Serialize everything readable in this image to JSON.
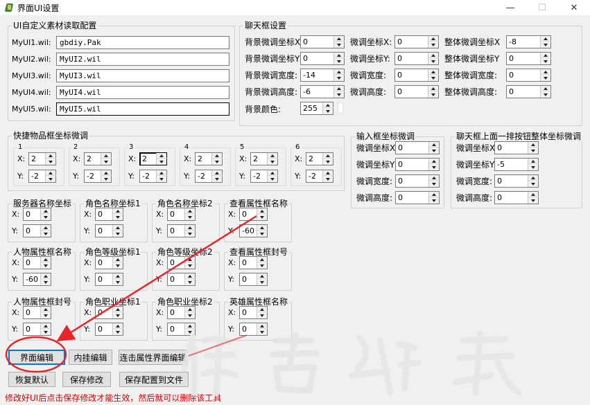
{
  "window": {
    "title": "界面UI设置",
    "minimize": "—",
    "maximize": "☐",
    "close": "✕"
  },
  "ui_group": {
    "title": "UI自定义素材读取配置",
    "rows": [
      {
        "label": "MyUI1.wil:",
        "value": "gbdiy.Pak"
      },
      {
        "label": "MyUI2.wil:",
        "value": "MyUI2.wil"
      },
      {
        "label": "MyUI3.wil:",
        "value": "MyUI3.wil"
      },
      {
        "label": "MyUI4.wil:",
        "value": "MyUI4.wil"
      },
      {
        "label": "MyUI5.wil:",
        "value": "MyUI5.wil"
      }
    ]
  },
  "chat_group": {
    "title": "聊天框设置",
    "col1": [
      {
        "label": "背景微调坐标X",
        "value": "0"
      },
      {
        "label": "背景微调坐标Y",
        "value": "0"
      },
      {
        "label": "背景微调宽度:",
        "value": "-14"
      },
      {
        "label": "背景微调高度:",
        "value": "-6"
      },
      {
        "label": "背景颜色:",
        "value": "255"
      }
    ],
    "col2": [
      {
        "label": "微调坐标X:",
        "value": "0"
      },
      {
        "label": "微调坐标Y:",
        "value": "0"
      },
      {
        "label": "微调宽度:",
        "value": "0"
      },
      {
        "label": "微调高度:",
        "value": "0"
      }
    ],
    "col3": [
      {
        "label": "整体微调坐标X",
        "value": "-8"
      },
      {
        "label": "整体微调坐标Y",
        "value": "0"
      },
      {
        "label": "整体微调宽度:",
        "value": "0"
      },
      {
        "label": "整体微调高度:",
        "value": "0"
      }
    ]
  },
  "quick_group": {
    "title": "快捷物品框坐标微调",
    "slots": [
      {
        "name": "1",
        "x": "2",
        "y": "-2"
      },
      {
        "name": "2",
        "x": "2",
        "y": "-2"
      },
      {
        "name": "3",
        "x": "2",
        "y": "-2"
      },
      {
        "name": "4",
        "x": "2",
        "y": "-2"
      },
      {
        "name": "5",
        "x": "2",
        "y": "-2"
      },
      {
        "name": "6",
        "x": "2",
        "y": "-2"
      }
    ]
  },
  "input_group": {
    "title": "输入框坐标微调",
    "rows": [
      {
        "label": "微调坐标X",
        "value": "0"
      },
      {
        "label": "微调坐标Y",
        "value": "0"
      },
      {
        "label": "微调宽度:",
        "value": "0"
      },
      {
        "label": "微调高度:",
        "value": "0"
      }
    ]
  },
  "chatbtn_group": {
    "title": "聊天框上面一排按钮整体坐标微调",
    "rows": [
      {
        "label": "微调坐标X",
        "value": "0"
      },
      {
        "label": "微调坐标Y",
        "value": "-5"
      },
      {
        "label": "微调宽度:",
        "value": "0"
      },
      {
        "label": "微调高度:",
        "value": "0"
      }
    ]
  },
  "coord_groups": [
    {
      "title": "服务器名称坐标",
      "x": "0",
      "y": "0"
    },
    {
      "title": "角色名称坐标1",
      "x": "0",
      "y": "0"
    },
    {
      "title": "角色名称坐标2",
      "x": "0",
      "y": "0"
    },
    {
      "title": "查看属性框名称",
      "x": "0",
      "y": "-60"
    },
    {
      "title": "人物属性框名称",
      "x": "0",
      "y": "-60"
    },
    {
      "title": "角色等级坐标1",
      "x": "0",
      "y": "0"
    },
    {
      "title": "角色等级坐标2",
      "x": "0",
      "y": "0"
    },
    {
      "title": "查看属性框封号",
      "x": "0",
      "y": "0"
    },
    {
      "title": "人物属性框封号",
      "x": "0",
      "y": "0"
    },
    {
      "title": "角色职业坐标1",
      "x": "0",
      "y": "0"
    },
    {
      "title": "角色职业坐标2",
      "x": "0",
      "y": "0"
    },
    {
      "title": "英雄属性框名称",
      "x": "0",
      "y": "0"
    }
  ],
  "axis": {
    "x": "X:",
    "y": "Y:"
  },
  "buttons": {
    "ui_edit": "界面编辑",
    "plugin_edit": "内挂编辑",
    "attr_edit": "连击属性界面编辑",
    "restore": "恢复默认",
    "save": "保存修改",
    "save_file": "保存配置到文件"
  },
  "status": "修改好UI后点击保存修改才能生效，然后就可以删除该工具",
  "colors": {
    "status": "#e00000",
    "annotation": "#e8242a",
    "focus": "#0078d7"
  }
}
